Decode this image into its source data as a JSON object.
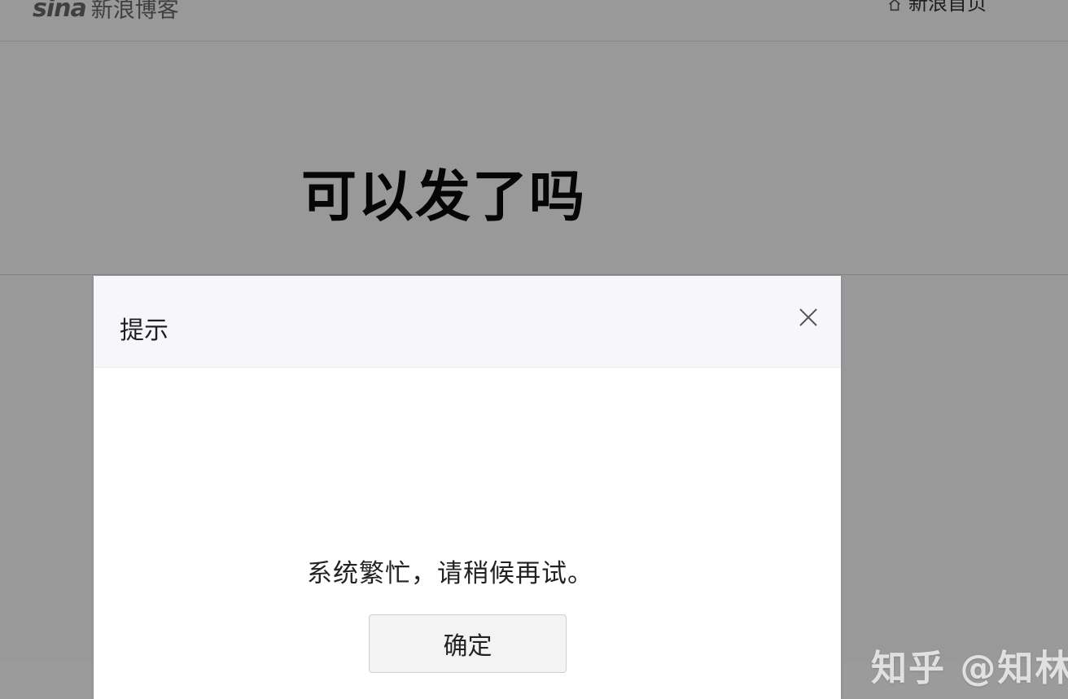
{
  "header": {
    "logo_mark": "sina",
    "logo_text": "新浪博客",
    "home_link": "新浪首页"
  },
  "post": {
    "title": "可以发了吗"
  },
  "dialog": {
    "title": "提示",
    "message": "系统繁忙，请稍候再试。",
    "confirm_label": "确定"
  },
  "watermark": {
    "text": "知乎 @知林"
  },
  "colors": {
    "overlay": "#000000",
    "dialog_header": "#f7f7fb",
    "button_bg": "#f3f3f3"
  }
}
